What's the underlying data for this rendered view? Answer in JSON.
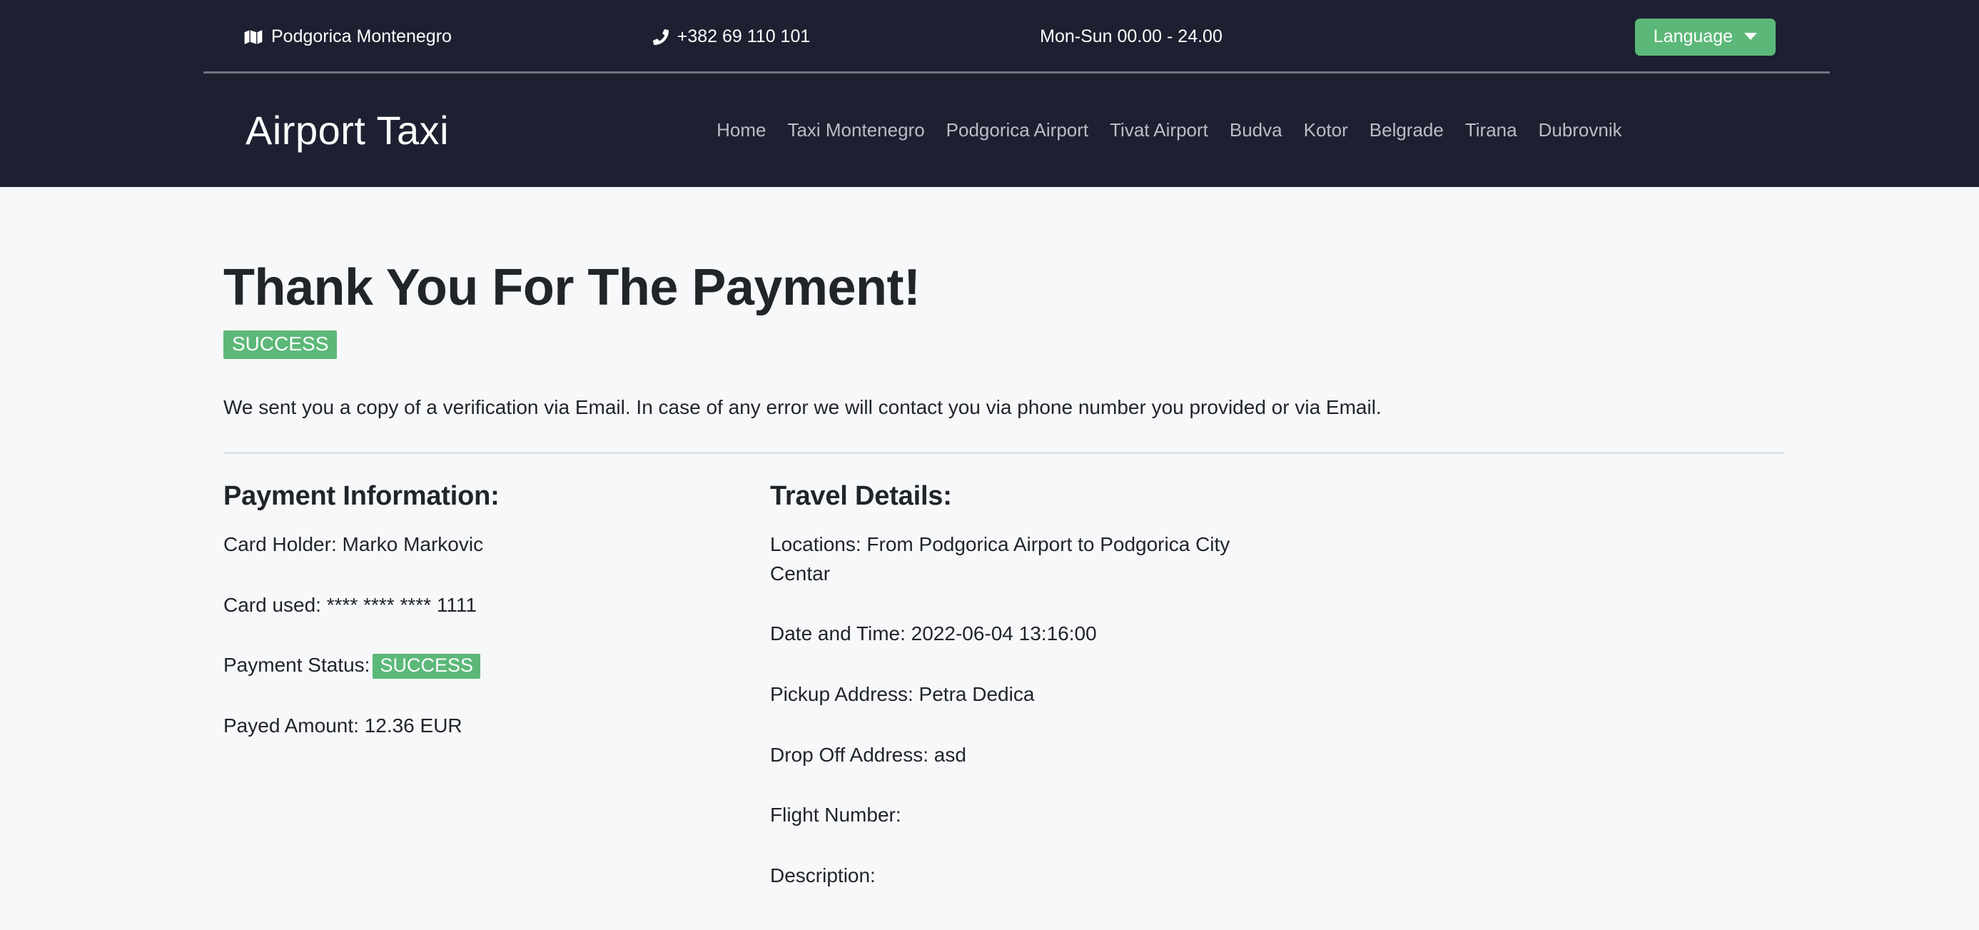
{
  "topbar": {
    "location_icon": "map-icon",
    "location": "Podgorica Montenegro",
    "phone_icon": "phone-icon",
    "phone": "+382 69 110 101",
    "hours": "Mon-Sun 00.00 - 24.00",
    "language_label": "Language",
    "language_caret_icon": "chevron-down-icon"
  },
  "nav": {
    "brand": "Airport Taxi",
    "links": [
      {
        "label": "Home"
      },
      {
        "label": "Taxi Montenegro"
      },
      {
        "label": "Podgorica Airport"
      },
      {
        "label": "Tivat Airport"
      },
      {
        "label": "Budva"
      },
      {
        "label": "Kotor"
      },
      {
        "label": "Belgrade"
      },
      {
        "label": "Tirana"
      },
      {
        "label": "Dubrovnik"
      }
    ]
  },
  "main": {
    "title": "Thank You For The Payment!",
    "status_badge": "SUCCESS",
    "lede": "We sent you a copy of a verification via Email. In case of any error we will contact you via phone number you provided or via Email.",
    "payment": {
      "heading": "Payment Information:",
      "card_holder": "Card Holder: Marko Markovic",
      "card_used": "Card used: **** **** **** 1111",
      "payment_status_label": "Payment Status:",
      "payment_status_value": "SUCCESS",
      "payed_amount": "Payed Amount: 12.36 EUR"
    },
    "travel": {
      "heading": "Travel Details:",
      "locations": "Locations: From Podgorica Airport to Podgorica City Centar",
      "date_and_time": "Date and Time: 2022-06-04 13:16:00",
      "pickup_address": "Pickup Address: Petra Dedica",
      "drop_off_address": "Drop Off Address: asd",
      "flight_number": "Flight Number:",
      "description": "Description:"
    }
  },
  "colors": {
    "header_bg": "#1c2030",
    "page_bg": "#f7f8fa",
    "accent_green": "#5cb878",
    "nav_link": "#b9bdc6",
    "text": "#212529",
    "divider": "#dee2e6"
  }
}
